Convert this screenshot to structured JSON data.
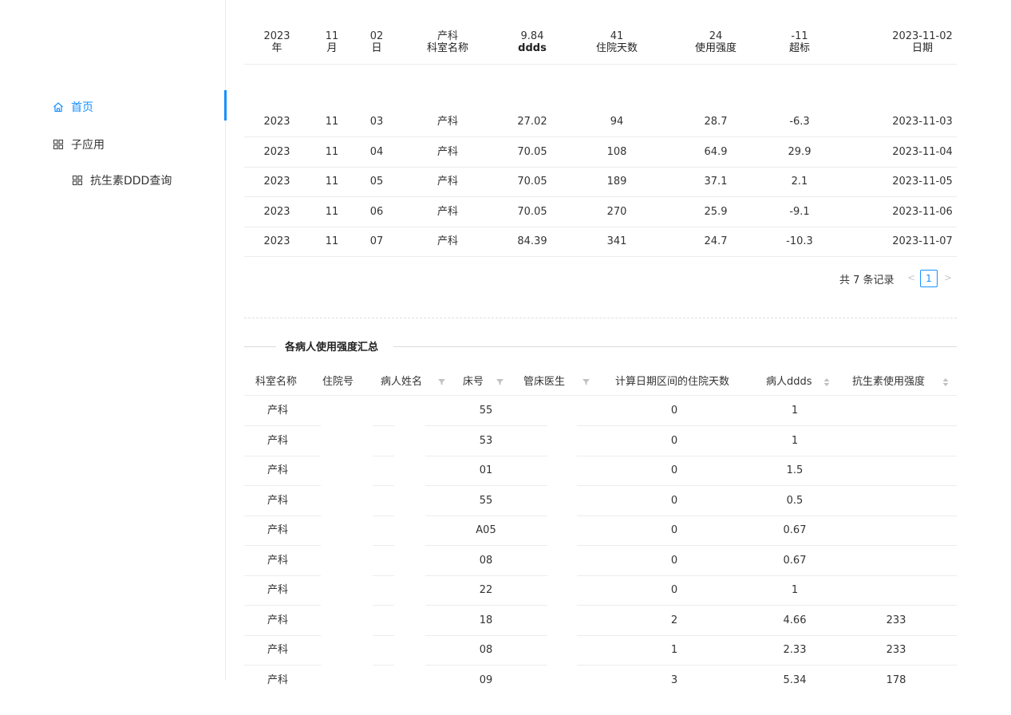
{
  "sidebar": {
    "items": [
      {
        "label": "首页",
        "icon": "home-icon"
      },
      {
        "label": "子应用",
        "icon": "grid-icon"
      },
      {
        "label": "抗生素DDD查询",
        "icon": "grid-icon"
      }
    ],
    "accent": "#1890ff"
  },
  "top_table": {
    "overlap_row": {
      "values": [
        "2023",
        "11",
        "02",
        "产科",
        "9.84",
        "41",
        "24",
        "-11",
        "2023-11-02"
      ],
      "headers": [
        "年",
        "月",
        "日",
        "科室名称",
        "ddds",
        "住院天数",
        "使用强度",
        "超标",
        "日期"
      ]
    },
    "rows": [
      [
        "2023",
        "11",
        "03",
        "产科",
        "27.02",
        "94",
        "28.7",
        "-6.3",
        "2023-11-03"
      ],
      [
        "2023",
        "11",
        "04",
        "产科",
        "70.05",
        "108",
        "64.9",
        "29.9",
        "2023-11-04"
      ],
      [
        "2023",
        "11",
        "05",
        "产科",
        "70.05",
        "189",
        "37.1",
        "2.1",
        "2023-11-05"
      ],
      [
        "2023",
        "11",
        "06",
        "产科",
        "70.05",
        "270",
        "25.9",
        "-9.1",
        "2023-11-06"
      ],
      [
        "2023",
        "11",
        "07",
        "产科",
        "84.39",
        "341",
        "24.7",
        "-10.3",
        "2023-11-07"
      ]
    ]
  },
  "pagination": {
    "total": "共 7 条记录",
    "prev": "<",
    "current": "1",
    "next": ">"
  },
  "section": {
    "title": "各病人使用强度汇总"
  },
  "bottom_table": {
    "headers": [
      "科室名称",
      "住院号",
      "病人姓名",
      "床号",
      "管床医生",
      "计算日期区间的住院天数",
      "病人ddds",
      "抗生素使用强度"
    ],
    "rows": [
      [
        "产科",
        "",
        "",
        "55",
        "",
        "0",
        "1",
        ""
      ],
      [
        "产科",
        "",
        "",
        "53",
        "",
        "0",
        "1",
        ""
      ],
      [
        "产科",
        "",
        "",
        "01",
        "",
        "0",
        "1.5",
        ""
      ],
      [
        "产科",
        "",
        "",
        "55",
        "",
        "0",
        "0.5",
        ""
      ],
      [
        "产科",
        "",
        "",
        "A05",
        "",
        "0",
        "0.67",
        ""
      ],
      [
        "产科",
        "",
        "",
        "08",
        "",
        "0",
        "0.67",
        ""
      ],
      [
        "产科",
        "",
        "",
        "22",
        "",
        "0",
        "1",
        ""
      ],
      [
        "产科",
        "",
        "",
        "18",
        "",
        "2",
        "4.66",
        "233"
      ],
      [
        "产科",
        "",
        "",
        "08",
        "",
        "1",
        "2.33",
        "233"
      ],
      [
        "产科",
        "",
        "",
        "09",
        "",
        "3",
        "5.34",
        "178"
      ]
    ]
  }
}
